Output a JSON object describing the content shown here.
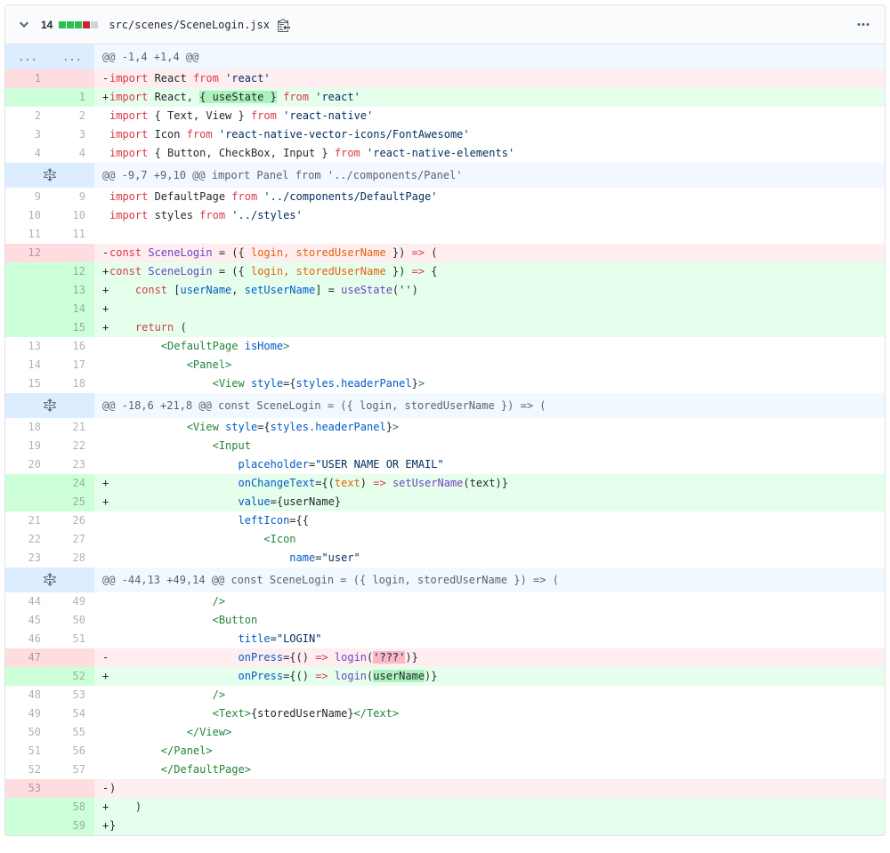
{
  "file_header": {
    "changes_count": "14",
    "diffstat_blocks": [
      "added",
      "added",
      "added",
      "deleted",
      "neutral"
    ],
    "file_path": "src/scenes/SceneLogin.jsx"
  },
  "icons": {
    "collapse": "chevron-down",
    "copy_path": "clippy",
    "file_options": "kebab-horizontal",
    "expand_hunk": "unfold"
  },
  "colors": {
    "keyword": "#d73a49",
    "string": "#032f62",
    "variable": "#005cc5",
    "function": "#6f42c1",
    "parameter": "#e36209",
    "jsx_tag": "#22863a",
    "text": "#24292e",
    "addition_bg": "#e6ffed",
    "addition_gutter_bg": "#cdffd8",
    "addition_word_bg": "#acf2bd",
    "deletion_bg": "#ffeef0",
    "deletion_gutter_bg": "#ffdce0",
    "deletion_word_bg": "#fdb8c0",
    "hunk_bg": "#f1f8ff",
    "hunk_gutter_bg": "#dbedff",
    "diffstat_added": "#2cbe4e",
    "diffstat_deleted": "#cb2431",
    "diffstat_neutral": "#d1d5da"
  },
  "diff": {
    "rows": [
      {
        "type": "hunk",
        "expandable": false,
        "old_label": "...",
        "new_label": "...",
        "text": "@@ -1,4 +1,4 @@"
      },
      {
        "type": "del",
        "old": "1",
        "new": "",
        "tokens": [
          {
            "t": "import",
            "c": "k"
          },
          {
            "t": " React ",
            "c": "p"
          },
          {
            "t": "from",
            "c": "k"
          },
          {
            "t": " ",
            "c": "p"
          },
          {
            "t": "'react'",
            "c": "s"
          }
        ]
      },
      {
        "type": "add",
        "old": "",
        "new": "1",
        "tokens": [
          {
            "t": "import",
            "c": "k"
          },
          {
            "t": " React, ",
            "c": "p"
          },
          {
            "t": "{ useState }",
            "c": "p",
            "h": "add"
          },
          {
            "t": " ",
            "c": "p"
          },
          {
            "t": "from",
            "c": "k"
          },
          {
            "t": " ",
            "c": "p"
          },
          {
            "t": "'react'",
            "c": "s"
          }
        ]
      },
      {
        "type": "ctx",
        "old": "2",
        "new": "2",
        "tokens": [
          {
            "t": "import",
            "c": "k"
          },
          {
            "t": " { Text, View } ",
            "c": "p"
          },
          {
            "t": "from",
            "c": "k"
          },
          {
            "t": " ",
            "c": "p"
          },
          {
            "t": "'react-native'",
            "c": "s"
          }
        ]
      },
      {
        "type": "ctx",
        "old": "3",
        "new": "3",
        "tokens": [
          {
            "t": "import",
            "c": "k"
          },
          {
            "t": " Icon ",
            "c": "p"
          },
          {
            "t": "from",
            "c": "k"
          },
          {
            "t": " ",
            "c": "p"
          },
          {
            "t": "'react-native-vector-icons/FontAwesome'",
            "c": "s"
          }
        ]
      },
      {
        "type": "ctx",
        "old": "4",
        "new": "4",
        "tokens": [
          {
            "t": "import",
            "c": "k"
          },
          {
            "t": " { Button, CheckBox, Input } ",
            "c": "p"
          },
          {
            "t": "from",
            "c": "k"
          },
          {
            "t": " ",
            "c": "p"
          },
          {
            "t": "'react-native-elements'",
            "c": "s"
          }
        ]
      },
      {
        "type": "hunk",
        "expandable": true,
        "text": "@@ -9,7 +9,10 @@ import Panel from '../components/Panel'"
      },
      {
        "type": "ctx",
        "old": "9",
        "new": "9",
        "tokens": [
          {
            "t": "import",
            "c": "k"
          },
          {
            "t": " DefaultPage ",
            "c": "p"
          },
          {
            "t": "from",
            "c": "k"
          },
          {
            "t": " ",
            "c": "p"
          },
          {
            "t": "'../components/DefaultPage'",
            "c": "s"
          }
        ]
      },
      {
        "type": "ctx",
        "old": "10",
        "new": "10",
        "tokens": [
          {
            "t": "import",
            "c": "k"
          },
          {
            "t": " styles ",
            "c": "p"
          },
          {
            "t": "from",
            "c": "k"
          },
          {
            "t": " ",
            "c": "p"
          },
          {
            "t": "'../styles'",
            "c": "s"
          }
        ]
      },
      {
        "type": "ctx",
        "old": "11",
        "new": "11",
        "tokens": []
      },
      {
        "type": "del",
        "old": "12",
        "new": "",
        "tokens": [
          {
            "t": "const",
            "c": "k"
          },
          {
            "t": " ",
            "c": "p"
          },
          {
            "t": "SceneLogin",
            "c": "f"
          },
          {
            "t": " = ({ ",
            "c": "p"
          },
          {
            "t": "login, storedUserName",
            "c": "o"
          },
          {
            "t": " }) ",
            "c": "p"
          },
          {
            "t": "=>",
            "c": "k"
          },
          {
            "t": " (",
            "c": "p"
          }
        ]
      },
      {
        "type": "add",
        "old": "",
        "new": "12",
        "tokens": [
          {
            "t": "const",
            "c": "k"
          },
          {
            "t": " ",
            "c": "p"
          },
          {
            "t": "SceneLogin",
            "c": "f"
          },
          {
            "t": " = ({ ",
            "c": "p"
          },
          {
            "t": "login, storedUserName",
            "c": "o"
          },
          {
            "t": " }) ",
            "c": "p"
          },
          {
            "t": "=>",
            "c": "k"
          },
          {
            "t": " {",
            "c": "p"
          }
        ]
      },
      {
        "type": "add",
        "old": "",
        "new": "13",
        "tokens": [
          {
            "t": "    ",
            "c": "p"
          },
          {
            "t": "const",
            "c": "k"
          },
          {
            "t": " [",
            "c": "p"
          },
          {
            "t": "userName",
            "c": "v"
          },
          {
            "t": ", ",
            "c": "p"
          },
          {
            "t": "setUserName",
            "c": "v"
          },
          {
            "t": "] = ",
            "c": "p"
          },
          {
            "t": "useState",
            "c": "f"
          },
          {
            "t": "(",
            "c": "p"
          },
          {
            "t": "''",
            "c": "s"
          },
          {
            "t": ")",
            "c": "p"
          }
        ]
      },
      {
        "type": "add",
        "old": "",
        "new": "14",
        "tokens": []
      },
      {
        "type": "add",
        "old": "",
        "new": "15",
        "tokens": [
          {
            "t": "    ",
            "c": "p"
          },
          {
            "t": "return",
            "c": "k"
          },
          {
            "t": " (",
            "c": "p"
          }
        ]
      },
      {
        "type": "ctx",
        "old": "13",
        "new": "16",
        "tokens": [
          {
            "t": "        ",
            "c": "p"
          },
          {
            "t": "<DefaultPage",
            "c": "t"
          },
          {
            "t": " ",
            "c": "p"
          },
          {
            "t": "isHome",
            "c": "v"
          },
          {
            "t": ">",
            "c": "t"
          }
        ]
      },
      {
        "type": "ctx",
        "old": "14",
        "new": "17",
        "tokens": [
          {
            "t": "            ",
            "c": "p"
          },
          {
            "t": "<Panel>",
            "c": "t"
          }
        ]
      },
      {
        "type": "ctx",
        "old": "15",
        "new": "18",
        "tokens": [
          {
            "t": "                ",
            "c": "p"
          },
          {
            "t": "<View",
            "c": "t"
          },
          {
            "t": " ",
            "c": "p"
          },
          {
            "t": "style",
            "c": "v"
          },
          {
            "t": "={",
            "c": "p"
          },
          {
            "t": "styles.headerPanel",
            "c": "v"
          },
          {
            "t": "}",
            "c": "p"
          },
          {
            "t": ">",
            "c": "t"
          }
        ]
      },
      {
        "type": "hunk",
        "expandable": true,
        "text": "@@ -18,6 +21,8 @@ const SceneLogin = ({ login, storedUserName }) => ("
      },
      {
        "type": "ctx",
        "old": "18",
        "new": "21",
        "tokens": [
          {
            "t": "            ",
            "c": "p"
          },
          {
            "t": "<View",
            "c": "t"
          },
          {
            "t": " ",
            "c": "p"
          },
          {
            "t": "style",
            "c": "v"
          },
          {
            "t": "={",
            "c": "p"
          },
          {
            "t": "styles.headerPanel",
            "c": "v"
          },
          {
            "t": "}",
            "c": "p"
          },
          {
            "t": ">",
            "c": "t"
          }
        ]
      },
      {
        "type": "ctx",
        "old": "19",
        "new": "22",
        "tokens": [
          {
            "t": "                ",
            "c": "p"
          },
          {
            "t": "<Input",
            "c": "t"
          }
        ]
      },
      {
        "type": "ctx",
        "old": "20",
        "new": "23",
        "tokens": [
          {
            "t": "                    ",
            "c": "p"
          },
          {
            "t": "placeholder",
            "c": "v"
          },
          {
            "t": "=",
            "c": "p"
          },
          {
            "t": "\"USER NAME OR EMAIL\"",
            "c": "s"
          }
        ]
      },
      {
        "type": "add",
        "old": "",
        "new": "24",
        "tokens": [
          {
            "t": "                    ",
            "c": "p"
          },
          {
            "t": "onChangeText",
            "c": "v"
          },
          {
            "t": "={(",
            "c": "p"
          },
          {
            "t": "text",
            "c": "o"
          },
          {
            "t": ") ",
            "c": "p"
          },
          {
            "t": "=>",
            "c": "k"
          },
          {
            "t": " ",
            "c": "p"
          },
          {
            "t": "setUserName",
            "c": "f"
          },
          {
            "t": "(text)}",
            "c": "p"
          }
        ]
      },
      {
        "type": "add",
        "old": "",
        "new": "25",
        "tokens": [
          {
            "t": "                    ",
            "c": "p"
          },
          {
            "t": "value",
            "c": "v"
          },
          {
            "t": "={userName}",
            "c": "p"
          }
        ]
      },
      {
        "type": "ctx",
        "old": "21",
        "new": "26",
        "tokens": [
          {
            "t": "                    ",
            "c": "p"
          },
          {
            "t": "leftIcon",
            "c": "v"
          },
          {
            "t": "={{",
            "c": "p"
          }
        ]
      },
      {
        "type": "ctx",
        "old": "22",
        "new": "27",
        "tokens": [
          {
            "t": "                        ",
            "c": "p"
          },
          {
            "t": "<Icon",
            "c": "t"
          }
        ]
      },
      {
        "type": "ctx",
        "old": "23",
        "new": "28",
        "tokens": [
          {
            "t": "                            ",
            "c": "p"
          },
          {
            "t": "name",
            "c": "v"
          },
          {
            "t": "=",
            "c": "p"
          },
          {
            "t": "\"user\"",
            "c": "s"
          }
        ]
      },
      {
        "type": "hunk",
        "expandable": true,
        "text": "@@ -44,13 +49,14 @@ const SceneLogin = ({ login, storedUserName }) => ("
      },
      {
        "type": "ctx",
        "old": "44",
        "new": "49",
        "tokens": [
          {
            "t": "                ",
            "c": "p"
          },
          {
            "t": "/>",
            "c": "t"
          }
        ]
      },
      {
        "type": "ctx",
        "old": "45",
        "new": "50",
        "tokens": [
          {
            "t": "                ",
            "c": "p"
          },
          {
            "t": "<Button",
            "c": "t"
          }
        ]
      },
      {
        "type": "ctx",
        "old": "46",
        "new": "51",
        "tokens": [
          {
            "t": "                    ",
            "c": "p"
          },
          {
            "t": "title",
            "c": "v"
          },
          {
            "t": "=",
            "c": "p"
          },
          {
            "t": "\"LOGIN\"",
            "c": "s"
          }
        ]
      },
      {
        "type": "del",
        "old": "47",
        "new": "",
        "tokens": [
          {
            "t": "                    ",
            "c": "p"
          },
          {
            "t": "onPress",
            "c": "v"
          },
          {
            "t": "={() ",
            "c": "p"
          },
          {
            "t": "=>",
            "c": "k"
          },
          {
            "t": " ",
            "c": "p"
          },
          {
            "t": "login",
            "c": "f"
          },
          {
            "t": "(",
            "c": "p"
          },
          {
            "t": "'???'",
            "c": "s",
            "h": "del"
          },
          {
            "t": ")}",
            "c": "p"
          }
        ]
      },
      {
        "type": "add",
        "old": "",
        "new": "52",
        "tokens": [
          {
            "t": "                    ",
            "c": "p"
          },
          {
            "t": "onPress",
            "c": "v"
          },
          {
            "t": "={() ",
            "c": "p"
          },
          {
            "t": "=>",
            "c": "k"
          },
          {
            "t": " ",
            "c": "p"
          },
          {
            "t": "login",
            "c": "f"
          },
          {
            "t": "(",
            "c": "p"
          },
          {
            "t": "userName",
            "c": "p",
            "h": "add"
          },
          {
            "t": ")}",
            "c": "p"
          }
        ]
      },
      {
        "type": "ctx",
        "old": "48",
        "new": "53",
        "tokens": [
          {
            "t": "                ",
            "c": "p"
          },
          {
            "t": "/>",
            "c": "t"
          }
        ]
      },
      {
        "type": "ctx",
        "old": "49",
        "new": "54",
        "tokens": [
          {
            "t": "                ",
            "c": "p"
          },
          {
            "t": "<Text>",
            "c": "t"
          },
          {
            "t": "{storedUserName}",
            "c": "p"
          },
          {
            "t": "</Text>",
            "c": "t"
          }
        ]
      },
      {
        "type": "ctx",
        "old": "50",
        "new": "55",
        "tokens": [
          {
            "t": "            ",
            "c": "p"
          },
          {
            "t": "</View>",
            "c": "t"
          }
        ]
      },
      {
        "type": "ctx",
        "old": "51",
        "new": "56",
        "tokens": [
          {
            "t": "        ",
            "c": "p"
          },
          {
            "t": "</Panel>",
            "c": "t"
          }
        ]
      },
      {
        "type": "ctx",
        "old": "52",
        "new": "57",
        "tokens": [
          {
            "t": "        ",
            "c": "p"
          },
          {
            "t": "</DefaultPage>",
            "c": "t"
          }
        ]
      },
      {
        "type": "del",
        "old": "53",
        "new": "",
        "tokens": [
          {
            "t": ")",
            "c": "p"
          }
        ]
      },
      {
        "type": "add",
        "old": "",
        "new": "58",
        "tokens": [
          {
            "t": "    )",
            "c": "p"
          }
        ]
      },
      {
        "type": "add",
        "old": "",
        "new": "59",
        "tokens": [
          {
            "t": "}",
            "c": "p"
          }
        ]
      }
    ]
  }
}
